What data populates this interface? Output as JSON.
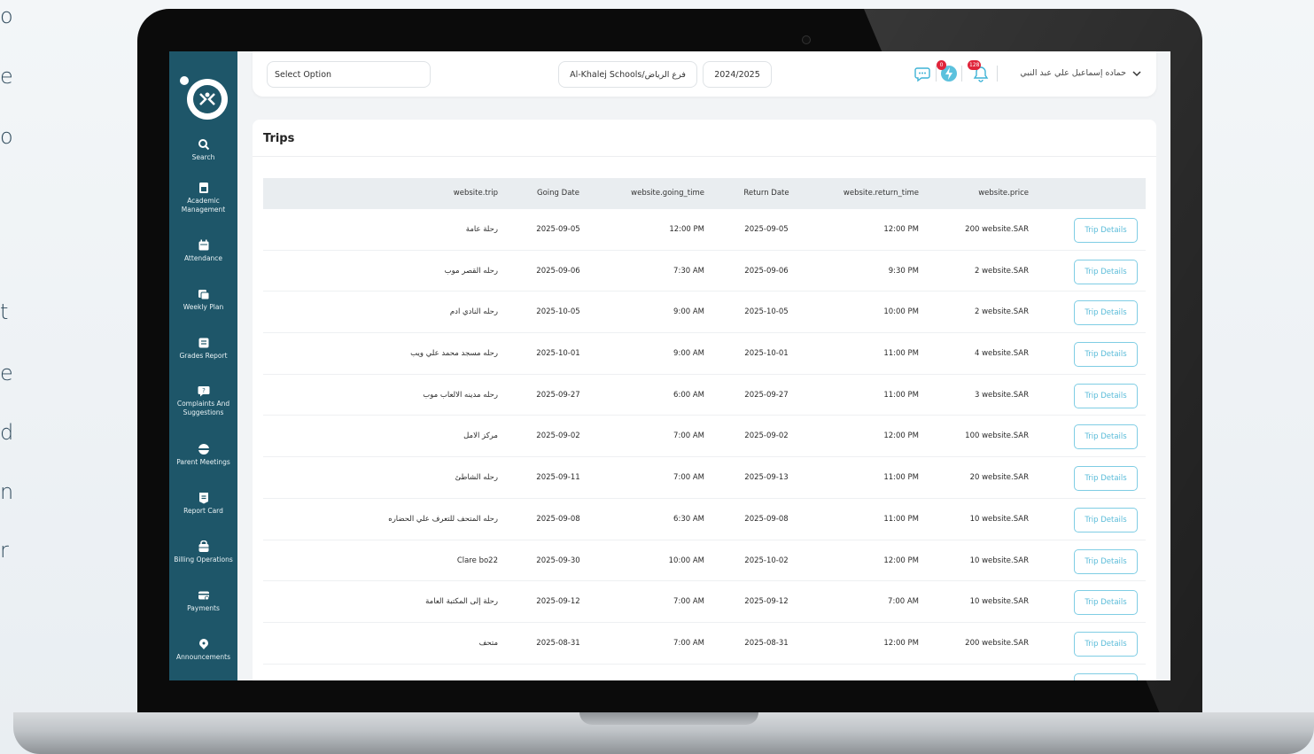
{
  "side_letters": [
    "o",
    "e",
    "o",
    "t",
    "e",
    "d",
    "n",
    "r"
  ],
  "sidebar": {
    "items": [
      {
        "label": "Search",
        "icon": "search-icon"
      },
      {
        "label": "Academic Management",
        "icon": "academic-icon"
      },
      {
        "label": "Attendance",
        "icon": "calendar-icon"
      },
      {
        "label": "Weekly Plan",
        "icon": "weekly-plan-icon"
      },
      {
        "label": "Grades Report",
        "icon": "grades-icon"
      },
      {
        "label": "Complaints And Suggestions",
        "icon": "complaint-icon"
      },
      {
        "label": "Parent Meetings",
        "icon": "meetings-icon"
      },
      {
        "label": "Report Card",
        "icon": "report-card-icon"
      },
      {
        "label": "Billing Operations",
        "icon": "billing-icon"
      },
      {
        "label": "Payments",
        "icon": "payments-icon"
      },
      {
        "label": "Announcements",
        "icon": "announcement-icon"
      }
    ]
  },
  "topbar": {
    "select_placeholder": "Select Option",
    "school": "Al-Khalej Schools/فرع الرياض",
    "year": "2024/2025",
    "lightning_badge": "0",
    "bell_badge": "128",
    "user_name": "حماده إسماعيل علي عبد النبي"
  },
  "card": {
    "title": "Trips",
    "columns": [
      "website.trip",
      "Going Date",
      "website.going_time",
      "Return Date",
      "website.return_time",
      "website.price"
    ],
    "button_label": "Trip Details",
    "rows": [
      {
        "trip": "رحلة عامة",
        "going_date": "2025-09-05",
        "going_time": "12:00 PM",
        "return_date": "2025-09-05",
        "return_time": "12:00 PM",
        "price": "200 website.SAR"
      },
      {
        "trip": "رحله القصر موب",
        "going_date": "2025-09-06",
        "going_time": "7:30 AM",
        "return_date": "2025-09-06",
        "return_time": "9:30 PM",
        "price": "2 website.SAR"
      },
      {
        "trip": "رحله النادي ادم",
        "going_date": "2025-10-05",
        "going_time": "9:00 AM",
        "return_date": "2025-10-05",
        "return_time": "10:00 PM",
        "price": "2 website.SAR"
      },
      {
        "trip": "رحله مسجد محمد علي ويب",
        "going_date": "2025-10-01",
        "going_time": "9:00 AM",
        "return_date": "2025-10-01",
        "return_time": "11:00 PM",
        "price": "4 website.SAR"
      },
      {
        "trip": "رحله مدينه الالعاب موب",
        "going_date": "2025-09-27",
        "going_time": "6:00 AM",
        "return_date": "2025-09-27",
        "return_time": "11:00 PM",
        "price": "3 website.SAR"
      },
      {
        "trip": "مركز الامل",
        "going_date": "2025-09-02",
        "going_time": "7:00 AM",
        "return_date": "2025-09-02",
        "return_time": "12:00 PM",
        "price": "100 website.SAR"
      },
      {
        "trip": "رحله الشاطئ",
        "going_date": "2025-09-11",
        "going_time": "7:00 AM",
        "return_date": "2025-09-13",
        "return_time": "11:00 PM",
        "price": "20 website.SAR"
      },
      {
        "trip": "رحله المتحف للتعرف علي الحضاره",
        "going_date": "2025-09-08",
        "going_time": "6:30 AM",
        "return_date": "2025-09-08",
        "return_time": "11:00 PM",
        "price": "10 website.SAR"
      },
      {
        "trip": "Clare bo22",
        "going_date": "2025-09-30",
        "going_time": "10:00 AM",
        "return_date": "2025-10-02",
        "return_time": "12:00 PM",
        "price": "10 website.SAR"
      },
      {
        "trip": "رحلة إلى المكتبة العامة",
        "going_date": "2025-09-12",
        "going_time": "7:00 AM",
        "return_date": "2025-09-12",
        "return_time": "7:00 AM",
        "price": "10 website.SAR"
      },
      {
        "trip": "متحف",
        "going_date": "2025-08-31",
        "going_time": "7:00 AM",
        "return_date": "2025-08-31",
        "return_time": "12:00 PM",
        "price": "200 website.SAR"
      }
    ]
  },
  "colors": {
    "sidebar": "#1e5669",
    "accent": "#5bbcd9",
    "badge": "#e0243a"
  }
}
